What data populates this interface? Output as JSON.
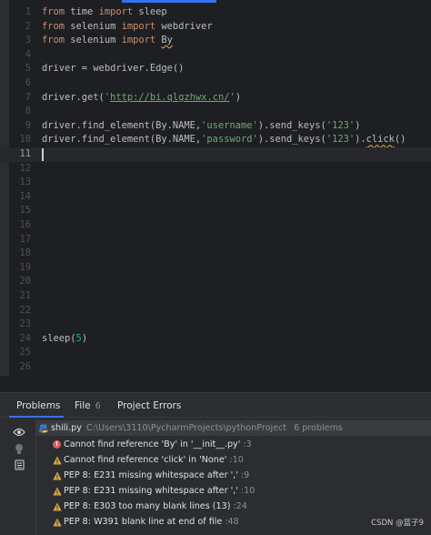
{
  "editor": {
    "lines": [
      {
        "n": "1",
        "tokens": [
          {
            "t": "from",
            "c": "kw"
          },
          {
            "t": " time "
          },
          {
            "t": "import",
            "c": "kw"
          },
          {
            "t": " sleep"
          }
        ]
      },
      {
        "n": "2",
        "tokens": [
          {
            "t": "from",
            "c": "kw"
          },
          {
            "t": " selenium "
          },
          {
            "t": "import",
            "c": "kw"
          },
          {
            "t": " webdriver"
          }
        ]
      },
      {
        "n": "3",
        "tokens": [
          {
            "t": "from",
            "c": "kw"
          },
          {
            "t": " selenium "
          },
          {
            "t": "import",
            "c": "kw"
          },
          {
            "t": " "
          },
          {
            "t": "By",
            "c": "wavy"
          }
        ]
      },
      {
        "n": "4",
        "tokens": []
      },
      {
        "n": "5",
        "tokens": [
          {
            "t": "driver = webdriver.Edge()"
          }
        ]
      },
      {
        "n": "6",
        "tokens": []
      },
      {
        "n": "7",
        "tokens": [
          {
            "t": "driver.get("
          },
          {
            "t": "'",
            "c": "str"
          },
          {
            "t": "http://bi.qlgzhwx.cn/",
            "c": "url"
          },
          {
            "t": "'",
            "c": "str"
          },
          {
            "t": ")"
          }
        ]
      },
      {
        "n": "8",
        "tokens": []
      },
      {
        "n": "9",
        "tokens": [
          {
            "t": "driver.find_element(By.NAME,"
          },
          {
            "t": "'username'",
            "c": "str"
          },
          {
            "t": ").send_keys("
          },
          {
            "t": "'123'",
            "c": "str"
          },
          {
            "t": ")"
          }
        ]
      },
      {
        "n": "10",
        "tokens": [
          {
            "t": "driver.find_element(By.NAME,"
          },
          {
            "t": "'password'",
            "c": "str"
          },
          {
            "t": ").send_keys("
          },
          {
            "t": "'123'",
            "c": "str"
          },
          {
            "t": ")."
          },
          {
            "t": "click",
            "c": "wavy"
          },
          {
            "t": "()"
          }
        ]
      },
      {
        "n": "11",
        "tokens": [],
        "current": true
      },
      {
        "n": "12",
        "tokens": []
      },
      {
        "n": "13",
        "tokens": []
      },
      {
        "n": "14",
        "tokens": []
      },
      {
        "n": "15",
        "tokens": []
      },
      {
        "n": "16",
        "tokens": []
      },
      {
        "n": "17",
        "tokens": []
      },
      {
        "n": "18",
        "tokens": []
      },
      {
        "n": "19",
        "tokens": []
      },
      {
        "n": "20",
        "tokens": []
      },
      {
        "n": "21",
        "tokens": []
      },
      {
        "n": "22",
        "tokens": []
      },
      {
        "n": "23",
        "tokens": []
      },
      {
        "n": "24",
        "tokens": [
          {
            "t": "sleep("
          },
          {
            "t": "5",
            "c": "num"
          },
          {
            "t": ")"
          }
        ]
      },
      {
        "n": "25",
        "tokens": []
      },
      {
        "n": "26",
        "tokens": []
      }
    ]
  },
  "panel": {
    "tabs": [
      {
        "label": "Problems",
        "count": "",
        "active": true
      },
      {
        "label": "File",
        "count": "6",
        "active": false
      },
      {
        "label": "Project Errors",
        "count": "",
        "active": false
      }
    ],
    "side_icons": [
      "eye-icon",
      "bulb-icon",
      "settings-icon"
    ],
    "file": {
      "name": "shili.py",
      "path": "C:\\Users\\3110\\PycharmProjects\\pythonProject",
      "count": "6 problems",
      "icon": "python-file-icon"
    },
    "problems": [
      {
        "severity": "error",
        "icon": "error-icon",
        "text": "Cannot find reference 'By' in '__init__.py'",
        "loc": ":3"
      },
      {
        "severity": "warning",
        "icon": "warning-icon",
        "text": "Cannot find reference 'click' in 'None'",
        "loc": ":10"
      },
      {
        "severity": "warning",
        "icon": "warning-icon",
        "text": "PEP 8: E231 missing whitespace after ','",
        "loc": ":9"
      },
      {
        "severity": "warning",
        "icon": "warning-icon",
        "text": "PEP 8: E231 missing whitespace after ','",
        "loc": ":10"
      },
      {
        "severity": "warning",
        "icon": "warning-icon",
        "text": "PEP 8: E303 too many blank lines (13)",
        "loc": ":24"
      },
      {
        "severity": "warning",
        "icon": "warning-icon",
        "text": "PEP 8: W391 blank line at end of file",
        "loc": ":48"
      }
    ]
  },
  "watermark": "CSDN @篮子9",
  "colors": {
    "background": "#1e1f22",
    "panel": "#2b2d30",
    "keyword": "#cf8e6d",
    "string": "#6aab73",
    "number": "#2aacb8",
    "error": "#db5c5c",
    "warning": "#d5a54a",
    "accent": "#3574f0"
  }
}
